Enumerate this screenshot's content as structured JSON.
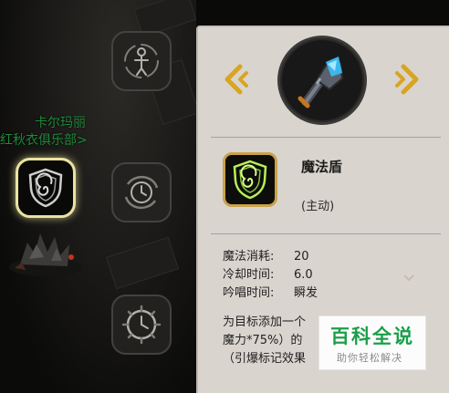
{
  "scene": {
    "npc_name": "卡尔玛丽",
    "npc_guild": "红秋衣俱乐部>"
  },
  "skill_slots": [
    {
      "icon": "figure-swirl-icon",
      "selected": false
    },
    {
      "icon": "shield-spiral-icon",
      "selected": true
    },
    {
      "icon": "clock-swirl-icon",
      "selected": false
    },
    {
      "icon": "clock-spiked-icon",
      "selected": false
    }
  ],
  "tooltip": {
    "weapon_icon": "crystal-mace-icon",
    "prev_icon": "chevron-left-icon",
    "next_icon": "chevron-right-icon",
    "skill_icon": "shield-spiral-icon",
    "skill_name": "魔法盾",
    "skill_type": "(主动)",
    "stats": [
      {
        "label": "魔法消耗:",
        "value": "20"
      },
      {
        "label": "冷却时间:",
        "value": "6.0"
      },
      {
        "label": "吟唱时间:",
        "value": "瞬发"
      }
    ],
    "description_lines": [
      "为目标添加一个",
      "魔力*75%）的",
      "（引爆标记效果"
    ]
  },
  "watermark": {
    "title": "百科全说",
    "subtitle": "助你轻松解决"
  },
  "colors": {
    "panel_bg": "#d9d4ce",
    "arrow_gold": "#d9a421",
    "selected_border": "#e9e3a0",
    "skill_glow": "#b8ef5a",
    "npc_name_green": "#1f8a3a",
    "watermark_green": "#1aa04a"
  }
}
